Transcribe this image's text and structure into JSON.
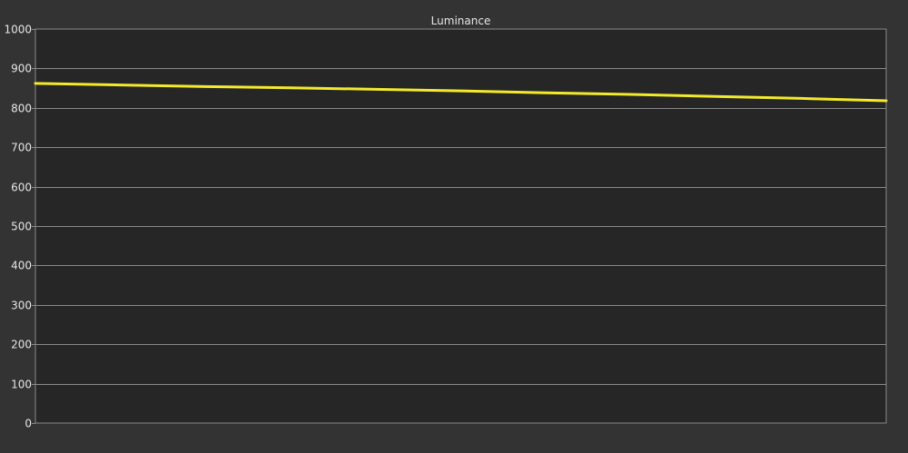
{
  "chart_data": {
    "type": "line",
    "title": "Luminance",
    "xlabel": "",
    "ylabel": "",
    "ylim": [
      0,
      1000
    ],
    "yticks": [
      0,
      100,
      200,
      300,
      400,
      500,
      600,
      700,
      800,
      900,
      1000
    ],
    "ytick_labels": [
      "0",
      "100",
      "200",
      "300",
      "400",
      "500",
      "600",
      "700",
      "800",
      "900",
      "1000"
    ],
    "grid": true,
    "legend": "none",
    "xlim": [
      0,
      100
    ],
    "series": [
      {
        "color": "#f2ea2b",
        "x": [
          0,
          10,
          20,
          30,
          40,
          50,
          60,
          70,
          80,
          90,
          100
        ],
        "y": [
          862,
          858,
          854,
          851,
          847,
          843,
          838,
          834,
          829,
          824,
          818
        ]
      }
    ],
    "colors": {
      "background": "#333333",
      "plot_background": "#262626",
      "grid": "#8a8a8a",
      "text": "#e6e6e6"
    }
  }
}
